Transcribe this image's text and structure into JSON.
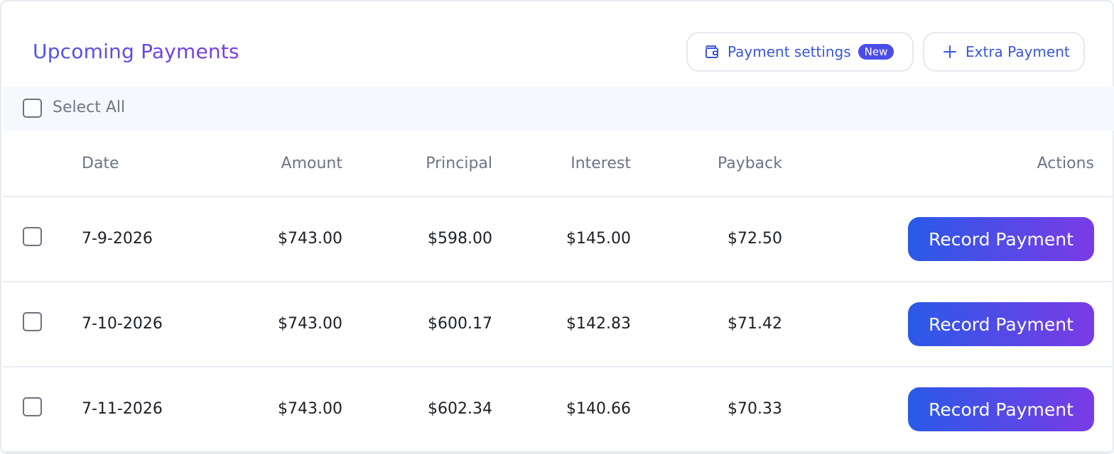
{
  "header": {
    "title": "Upcoming Payments",
    "settings_label": "Payment settings",
    "new_badge": "New",
    "extra_label": "Extra Payment"
  },
  "select_all": {
    "label": "Select All",
    "checked": false
  },
  "columns": {
    "date": "Date",
    "amount": "Amount",
    "principal": "Principal",
    "interest": "Interest",
    "payback": "Payback",
    "actions": "Actions"
  },
  "rows": [
    {
      "date": "7-9-2026",
      "amount": "$743.00",
      "principal": "$598.00",
      "interest": "$145.00",
      "payback": "$72.50",
      "action": "Record Payment"
    },
    {
      "date": "7-10-2026",
      "amount": "$743.00",
      "principal": "$600.17",
      "interest": "$142.83",
      "payback": "$71.42",
      "action": "Record Payment"
    },
    {
      "date": "7-11-2026",
      "amount": "$743.00",
      "principal": "$602.34",
      "interest": "$140.66",
      "payback": "$70.33",
      "action": "Record Payment"
    }
  ],
  "colors": {
    "title_gradient": [
      "#4a55e8",
      "#7d3be6"
    ],
    "button_gradient": [
      "#2a5ae8",
      "#7a3be6"
    ],
    "link_blue": "#3b56d9",
    "badge": "#4a4de8"
  },
  "icons": {
    "settings": "wallet-icon",
    "extra": "plus-icon"
  }
}
